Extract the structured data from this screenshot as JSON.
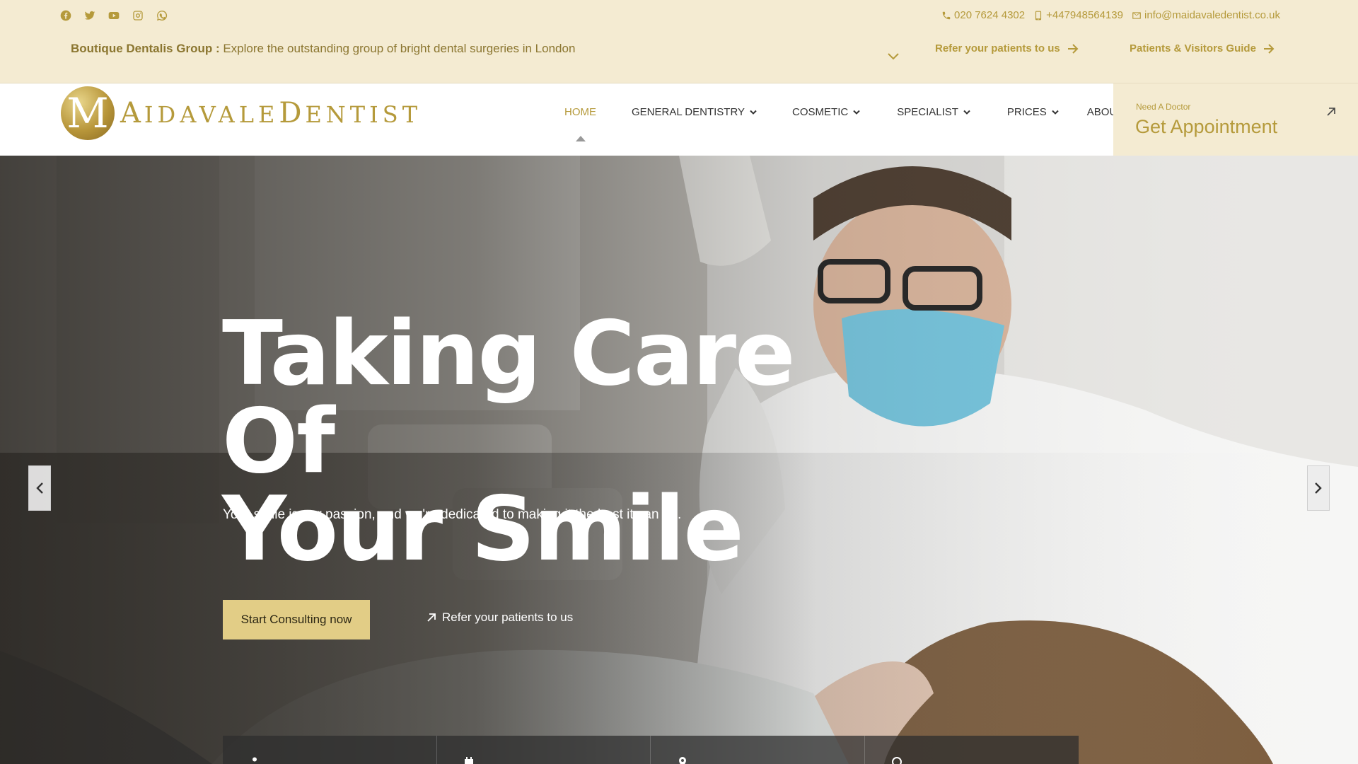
{
  "colors": {
    "brand_gold": "#b59a3b",
    "top_bg": "#f4ebd2",
    "button_bg": "#e2cd86",
    "nav_text": "#333333"
  },
  "socials": [
    {
      "icon": "facebook-icon"
    },
    {
      "icon": "twitter-icon"
    },
    {
      "icon": "youtube-icon"
    },
    {
      "icon": "instagram-icon"
    },
    {
      "icon": "whatsapp-icon"
    }
  ],
  "contacts": {
    "phone": "020 7624 4302",
    "mobile": "+447948564139",
    "email": "info@maidavaledentist.co.uk"
  },
  "group": {
    "label": "Boutique Dentalis Group :",
    "text": " Explore the outstanding group of bright dental surgeries in London"
  },
  "toplinks": {
    "refer": "Refer your patients to us",
    "guide": "Patients & Visitors Guide"
  },
  "logo": {
    "mark": "M",
    "text_parts": [
      "A",
      "IDAVALE",
      "D",
      "ENTIST"
    ]
  },
  "nav": {
    "items": [
      {
        "label": "HOME",
        "active": true,
        "dropdown": false
      },
      {
        "label": "GENERAL DENTISTRY",
        "dropdown": true
      },
      {
        "label": "COSMETIC",
        "dropdown": true
      },
      {
        "label": "SPECIALIST",
        "dropdown": true
      },
      {
        "label": "PRICES",
        "dropdown": true
      },
      {
        "label": "ABOUT",
        "dropdown": true
      }
    ]
  },
  "appointment": {
    "small": "Need A Doctor",
    "big": "Get Appointment"
  },
  "hero": {
    "title": "Taking Care Of\nYour Smile",
    "subtitle": "Your smile is our passion, and we're dedicated to making it the best it can be.",
    "cta_primary": "Start Consulting now",
    "cta_secondary": "Refer your patients to us"
  },
  "info_bar": {
    "cells": [
      {
        "icon": "user-icon"
      },
      {
        "icon": "calendar-icon"
      },
      {
        "icon": "location-icon"
      },
      {
        "icon": "question-icon"
      }
    ]
  }
}
